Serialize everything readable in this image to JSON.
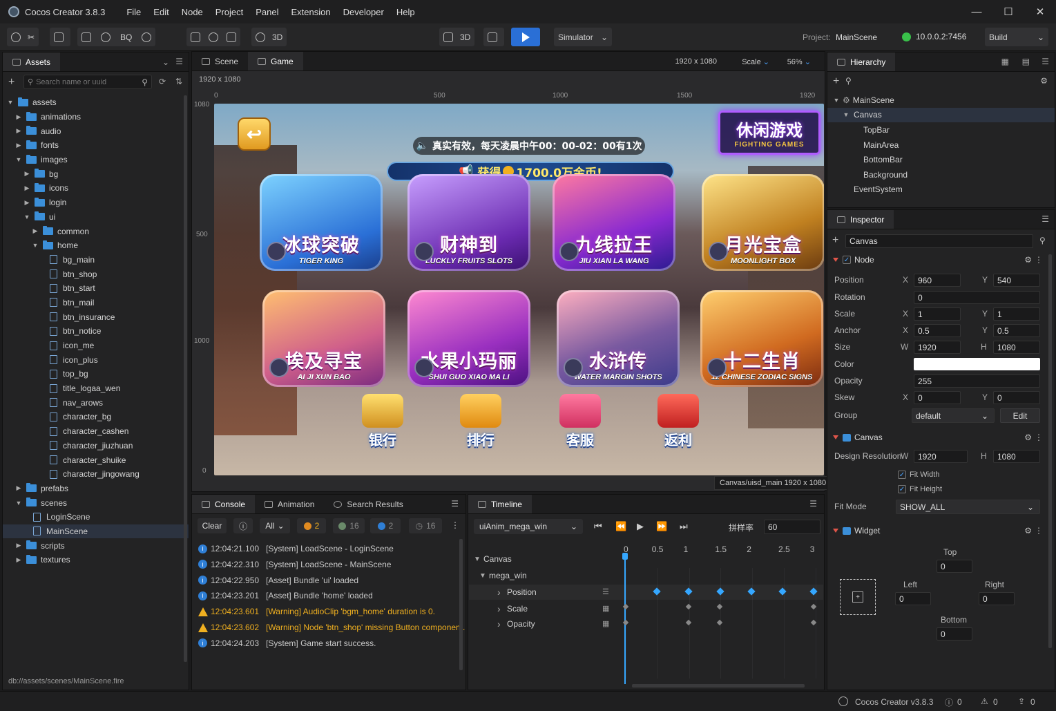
{
  "app": {
    "title": "Cocos Creator 3.8.3",
    "menu": [
      "File",
      "Edit",
      "Node",
      "Project",
      "Panel",
      "Extension",
      "Developer",
      "Help"
    ]
  },
  "toolbar": {
    "bq": "BQ",
    "mode3d_a": "3D",
    "mode3d_b": "3D",
    "simulator": "Simulator",
    "project_label": "Project:",
    "project_name": "MainScene",
    "ip": "10.0.0.2:7456",
    "build": "Build"
  },
  "assets": {
    "tab": "Assets",
    "search_placeholder": "Search name or uuid",
    "tree": [
      {
        "label": "assets",
        "depth": 0,
        "type": "folder",
        "open": true
      },
      {
        "label": "animations",
        "depth": 1,
        "type": "folder"
      },
      {
        "label": "audio",
        "depth": 1,
        "type": "folder"
      },
      {
        "label": "fonts",
        "depth": 1,
        "type": "folder"
      },
      {
        "label": "images",
        "depth": 1,
        "type": "folder",
        "open": true
      },
      {
        "label": "bg",
        "depth": 2,
        "type": "folder"
      },
      {
        "label": "icons",
        "depth": 2,
        "type": "folder"
      },
      {
        "label": "login",
        "depth": 2,
        "type": "folder"
      },
      {
        "label": "ui",
        "depth": 2,
        "type": "folder",
        "open": true
      },
      {
        "label": "common",
        "depth": 3,
        "type": "folder"
      },
      {
        "label": "home",
        "depth": 3,
        "type": "folder",
        "open": true
      },
      {
        "label": "bg_main",
        "depth": 4,
        "type": "file"
      },
      {
        "label": "btn_shop",
        "depth": 4,
        "type": "file"
      },
      {
        "label": "btn_start",
        "depth": 4,
        "type": "file"
      },
      {
        "label": "btn_mail",
        "depth": 4,
        "type": "file"
      },
      {
        "label": "btn_insurance",
        "depth": 4,
        "type": "file"
      },
      {
        "label": "btn_notice",
        "depth": 4,
        "type": "file"
      },
      {
        "label": "icon_me",
        "depth": 4,
        "type": "file"
      },
      {
        "label": "icon_plus",
        "depth": 4,
        "type": "file"
      },
      {
        "label": "top_bg",
        "depth": 4,
        "type": "file"
      },
      {
        "label": "title_logaa_wen",
        "depth": 4,
        "type": "file"
      },
      {
        "label": "nav_arows",
        "depth": 4,
        "type": "file"
      },
      {
        "label": "character_bg",
        "depth": 4,
        "type": "file"
      },
      {
        "label": "character_cashen",
        "depth": 4,
        "type": "file"
      },
      {
        "label": "character_jiuzhuan",
        "depth": 4,
        "type": "file"
      },
      {
        "label": "character_shuike",
        "depth": 4,
        "type": "file"
      },
      {
        "label": "character_jingowang",
        "depth": 4,
        "type": "file"
      },
      {
        "label": "prefabs",
        "depth": 1,
        "type": "folder"
      },
      {
        "label": "scenes",
        "depth": 1,
        "type": "folder",
        "open": true
      },
      {
        "label": "LoginScene",
        "depth": 2,
        "type": "file"
      },
      {
        "label": "MainScene",
        "depth": 2,
        "type": "file",
        "selected": true
      },
      {
        "label": "scripts",
        "depth": 1,
        "type": "folder"
      },
      {
        "label": "textures",
        "depth": 1,
        "type": "folder"
      }
    ],
    "footer": "db://assets/scenes/MainScene.fire"
  },
  "scene_tabs": {
    "scene": "Scene",
    "game": "Game",
    "resolution": "1920 x 1080",
    "scale": "Scale",
    "zoom": "56%",
    "res_label": "1920 x 1080"
  },
  "rulers": {
    "top": [
      "0",
      "500",
      "1000",
      "1500",
      "1920"
    ],
    "left": [
      "1080",
      "500",
      "1000",
      "0"
    ]
  },
  "game": {
    "top_notice": "真实有效，每天凌晨中午00：00-02：00有1次",
    "jackpot": "获得",
    "jackpot_amount": "1700.0万金币!",
    "logo_cn": "休闲游戏",
    "logo_en": "FIGHTING GAMES",
    "cards": [
      {
        "cn": "冰球突破",
        "en": "TIGER KING"
      },
      {
        "cn": "财神到",
        "en": "LUCKLY FRUITS SLOTS"
      },
      {
        "cn": "九线拉王",
        "en": "JIU XIAN LA WANG"
      },
      {
        "cn": "月光宝盒",
        "en": "MOONLIGHT BOX"
      },
      {
        "cn": "埃及寻宝",
        "en": "AI JI XUN BAO"
      },
      {
        "cn": "水果小玛丽",
        "en": "SHUI GUO XIAO MA LI"
      },
      {
        "cn": "水浒传",
        "en": "WATER MARGIN SHOTS"
      },
      {
        "cn": "十二生肖",
        "en": "12 CHINESE ZODIAC SIGNS"
      }
    ],
    "bottom": [
      "银行",
      "排行",
      "客服",
      "返利"
    ],
    "path_label": "Canvas/uisd_main 1920 x 1080"
  },
  "hierarchy": {
    "tab": "Hierarchy",
    "items": [
      {
        "label": "MainScene",
        "depth": 0
      },
      {
        "label": "Canvas",
        "depth": 1,
        "selected": true
      },
      {
        "label": "TopBar",
        "depth": 2
      },
      {
        "label": "MainArea",
        "depth": 2
      },
      {
        "label": "BottomBar",
        "depth": 2
      },
      {
        "label": "Background",
        "depth": 2
      },
      {
        "label": "EventSystem",
        "depth": 1
      }
    ]
  },
  "inspector": {
    "tab": "Inspector",
    "node_name": "Canvas",
    "node_section": "Node",
    "position_label": "Position",
    "pos_x": "960",
    "pos_y": "540",
    "rotation_label": "Rotation",
    "rotation": "0",
    "scale_label": "Scale",
    "scale_x": "1",
    "scale_y": "1",
    "anchor_label": "Anchor",
    "anchor_x": "0.5",
    "anchor_y": "0.5",
    "size_label": "Size",
    "size_w": "1920",
    "size_h": "1080",
    "color_label": "Color",
    "color_value": "#ffffff",
    "opacity_label": "Opacity",
    "opacity": "255",
    "skew_label": "Skew",
    "skew_x": "0",
    "skew_y": "0",
    "group_label": "Group",
    "group": "default",
    "edit": "Edit",
    "canvas_section": "Canvas",
    "design_label": "Design Resolution",
    "design_w": "1920",
    "design_h": "1080",
    "fit_width": "Fit Width",
    "fit_height": "Fit Height",
    "fit_mode_label": "Fit Mode",
    "fit_mode": "SHOW_ALL",
    "widget_section": "Widget",
    "top": "Top",
    "top_v": "0",
    "left": "Left",
    "left_v": "0",
    "right": "Right",
    "right_v": "0",
    "bottom": "Bottom",
    "bottom_v": "0",
    "x": "X",
    "y": "Y",
    "w": "W",
    "h": "H"
  },
  "console": {
    "tabs": [
      "Console",
      "Animation",
      "Search Results"
    ],
    "clear": "Clear",
    "filter": "All",
    "c_warn": "2",
    "c_info": "16",
    "c_err": "2",
    "c_log": "16",
    "logs": [
      {
        "time": "12:04:21.100",
        "msg": "[System] LoadScene - LoginScene",
        "type": "info"
      },
      {
        "time": "12:04:22.310",
        "msg": "[System] LoadScene - MainScene",
        "type": "info"
      },
      {
        "time": "12:04:22.950",
        "msg": "[Asset] Bundle 'ui' loaded",
        "type": "info"
      },
      {
        "time": "12:04:23.201",
        "msg": "[Asset] Bundle 'home' loaded",
        "type": "info"
      },
      {
        "time": "12:04:23.601",
        "msg": "[Warning] AudioClip 'bgm_home' duration is 0.",
        "type": "warn"
      },
      {
        "time": "12:04:23.602",
        "msg": "[Warning] Node 'btn_shop' missing Button component.",
        "type": "warn"
      },
      {
        "time": "12:04:24.203",
        "msg": "[System] Game start success.",
        "type": "info"
      }
    ]
  },
  "timeline": {
    "tab": "Timeline",
    "clip": "uiAnim_mega_win",
    "sample_label": "拼样率",
    "sample": "60",
    "ticks": [
      "0",
      "0.5",
      "1",
      "1.5",
      "2",
      "2.5",
      "3"
    ],
    "tracks": [
      {
        "label": "Canvas",
        "depth": 0
      },
      {
        "label": "mega_win",
        "depth": 1
      },
      {
        "label": "Position",
        "depth": 2
      },
      {
        "label": "Scale",
        "depth": 2
      },
      {
        "label": "Opacity",
        "depth": 2
      }
    ]
  },
  "status": {
    "version": "Cocos Creator v3.8.3",
    "errors": "0",
    "warnings": "0",
    "notices": "0"
  }
}
